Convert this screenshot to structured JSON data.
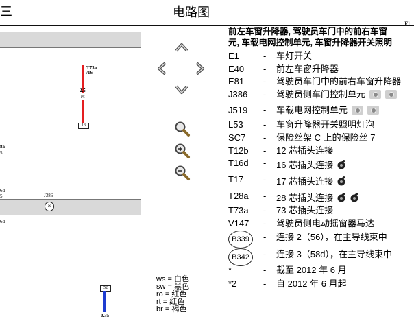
{
  "topbar": {
    "menu_glyph": "三",
    "title": "电路图",
    "corner": "El"
  },
  "diagram": {
    "wire_top_label_1": "T73a",
    "wire_top_label_2": "/16",
    "wire_size": "2.5",
    "wire_color": "rt",
    "wire_end_tag": "13",
    "left_label_1": "8a",
    "left_label_2": "5",
    "left_label_3": "6d",
    "left_label_4": "5",
    "left_label_5": "6d",
    "component_label": "J386",
    "bottom_tag": "52",
    "bottom_size": "0.35",
    "wire_top_color": "#e41e20",
    "wire_bottom_color": "#1e3cd0"
  },
  "nav": {
    "up": "pan-up",
    "left": "pan-left",
    "right": "pan-right",
    "down": "pan-down",
    "zoom_fit": "magnifier",
    "zoom_in": "magnifier-plus",
    "zoom_out": "magnifier-minus"
  },
  "color_legend": [
    "ws = 白色",
    "sw = 黑色",
    "ro = 红色",
    "rt = 红色",
    "br = 褐色"
  ],
  "info": {
    "heading_line1": "前左车窗升降器, 驾驶员车门中的前右车窗",
    "heading_line2": "元, 车载电网控制单元, 车窗升降器开关照明",
    "rows": [
      {
        "code": "E1",
        "dash": "-",
        "desc": "车灯开关"
      },
      {
        "code": "E40",
        "dash": "-",
        "desc": "前左车窗升降器"
      },
      {
        "code": "E81",
        "dash": "-",
        "desc": "驾驶员车门中的前右车窗升降器"
      },
      {
        "code": "J386",
        "dash": "-",
        "desc": "驾驶员侧车门控制单元"
      },
      {
        "code": "J519",
        "dash": "-",
        "desc": "车载电网控制单元"
      },
      {
        "code": "L53",
        "dash": "-",
        "desc": "车窗升降器开关照明灯泡"
      },
      {
        "code": "SC7",
        "dash": "-",
        "desc": "保险丝架 C 上的保险丝 7"
      },
      {
        "code": "T12b",
        "dash": "-",
        "desc": "12 芯插头连接"
      },
      {
        "code": "T16d",
        "dash": "-",
        "desc": "16 芯插头连接"
      },
      {
        "code": "T17",
        "dash": "-",
        "desc": "17 芯插头连接"
      },
      {
        "code": "T28a",
        "dash": "-",
        "desc": "28 芯插头连接"
      },
      {
        "code": "T73a",
        "dash": "-",
        "desc": "73 芯插头连接"
      },
      {
        "code": "V147",
        "dash": "-",
        "desc": "驾驶员侧电动摇窗器马达"
      },
      {
        "code": "B339",
        "dash": "-",
        "desc": "连接 2（56），在主导线束中"
      },
      {
        "code": "B342",
        "dash": "-",
        "desc": "连接 3（58d），在主导线束中"
      },
      {
        "code": "*",
        "dash": "-",
        "desc": "截至 2012 年 6 月"
      },
      {
        "code": "*2",
        "dash": "-",
        "desc": "自 2012 年 6 月起"
      }
    ]
  }
}
